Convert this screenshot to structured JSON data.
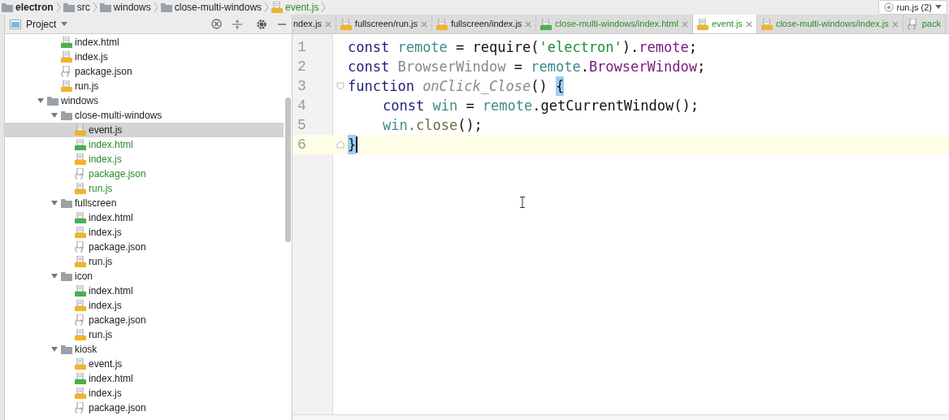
{
  "breadcrumb": [
    {
      "label": "electron",
      "kind": "folder",
      "bold": true
    },
    {
      "label": "src",
      "kind": "folder",
      "bold": false
    },
    {
      "label": "windows",
      "kind": "folder",
      "bold": false
    },
    {
      "label": "close-multi-windows",
      "kind": "folder",
      "bold": false
    },
    {
      "label": "event.js",
      "kind": "js",
      "bold": false
    }
  ],
  "run_config": {
    "label": "run.js (2)"
  },
  "project_panel": {
    "title": "Project"
  },
  "tree": [
    {
      "children": [
        {
          "label": "index.html",
          "kind": "html",
          "modified": false,
          "selected": false
        },
        {
          "label": "index.js",
          "kind": "js",
          "modified": false,
          "selected": false
        },
        {
          "label": "package.json",
          "kind": "json",
          "modified": false,
          "selected": false
        },
        {
          "label": "run.js",
          "kind": "js",
          "modified": false,
          "selected": false
        }
      ]
    },
    {
      "label": "windows",
      "kind": "folder",
      "expanded": true,
      "modified": false,
      "selected": false,
      "children": [
        {
          "label": "close-multi-windows",
          "kind": "folder",
          "expanded": true,
          "modified": false,
          "selected": false,
          "children": [
            {
              "label": "event.js",
              "kind": "js",
              "modified": false,
              "selected": true
            },
            {
              "label": "index.html",
              "kind": "html",
              "modified": true,
              "selected": false
            },
            {
              "label": "index.js",
              "kind": "js",
              "modified": true,
              "selected": false
            },
            {
              "label": "package.json",
              "kind": "json",
              "modified": true,
              "selected": false
            },
            {
              "label": "run.js",
              "kind": "js",
              "modified": true,
              "selected": false
            }
          ]
        },
        {
          "label": "fullscreen",
          "kind": "folder",
          "expanded": true,
          "modified": false,
          "selected": false,
          "children": [
            {
              "label": "index.html",
              "kind": "html",
              "modified": false,
              "selected": false
            },
            {
              "label": "index.js",
              "kind": "js",
              "modified": false,
              "selected": false
            },
            {
              "label": "package.json",
              "kind": "json",
              "modified": false,
              "selected": false
            },
            {
              "label": "run.js",
              "kind": "js",
              "modified": false,
              "selected": false
            }
          ]
        },
        {
          "label": "icon",
          "kind": "folder",
          "expanded": true,
          "modified": false,
          "selected": false,
          "children": [
            {
              "label": "index.html",
              "kind": "html",
              "modified": false,
              "selected": false
            },
            {
              "label": "index.js",
              "kind": "js",
              "modified": false,
              "selected": false
            },
            {
              "label": "package.json",
              "kind": "json",
              "modified": false,
              "selected": false
            },
            {
              "label": "run.js",
              "kind": "js",
              "modified": false,
              "selected": false
            }
          ]
        },
        {
          "label": "kiosk",
          "kind": "folder",
          "expanded": true,
          "modified": false,
          "selected": false,
          "children": [
            {
              "label": "event.js",
              "kind": "js",
              "modified": false,
              "selected": false
            },
            {
              "label": "index.html",
              "kind": "html",
              "modified": false,
              "selected": false
            },
            {
              "label": "index.js",
              "kind": "js",
              "modified": false,
              "selected": false
            },
            {
              "label": "package.json",
              "kind": "json",
              "modified": false,
              "selected": false
            }
          ]
        }
      ]
    }
  ],
  "tabs": [
    {
      "label": "ndex.js",
      "kind": "none",
      "modified": false,
      "selected": false,
      "closable": true
    },
    {
      "label": "fullscreen/run.js",
      "kind": "js",
      "modified": false,
      "selected": false,
      "closable": true
    },
    {
      "label": "fullscreen/index.js",
      "kind": "js",
      "modified": false,
      "selected": false,
      "closable": true
    },
    {
      "label": "close-multi-windows/index.html",
      "kind": "html",
      "modified": true,
      "selected": false,
      "closable": true
    },
    {
      "label": "event.js",
      "kind": "js",
      "modified": true,
      "selected": true,
      "closable": true
    },
    {
      "label": "close-multi-windows/index.js",
      "kind": "js",
      "modified": true,
      "selected": false,
      "closable": true
    },
    {
      "label": "pack",
      "kind": "json",
      "modified": true,
      "selected": false,
      "closable": false
    }
  ],
  "editor": {
    "lines": [
      {
        "number": "1",
        "indented": false,
        "current": false,
        "fold_open": false,
        "fold_close": false,
        "tokens": [
          {
            "text": "const ",
            "kind": "kw"
          },
          {
            "text": "remote",
            "kind": "local"
          },
          {
            "text": " = require(",
            "kind": "plain"
          },
          {
            "text": "'electron'",
            "kind": "str"
          },
          {
            "text": ").",
            "kind": "plain"
          },
          {
            "text": "remote",
            "kind": "prop"
          },
          {
            "text": ";",
            "kind": "plain"
          }
        ]
      },
      {
        "number": "2",
        "indented": false,
        "current": false,
        "fold_open": false,
        "fold_close": false,
        "tokens": [
          {
            "text": "const ",
            "kind": "kw"
          },
          {
            "text": "BrowserWindow",
            "kind": "unused"
          },
          {
            "text": " = ",
            "kind": "plain"
          },
          {
            "text": "remote",
            "kind": "local"
          },
          {
            "text": ".",
            "kind": "plain"
          },
          {
            "text": "BrowserWindow",
            "kind": "prop"
          },
          {
            "text": ";",
            "kind": "plain"
          }
        ]
      },
      {
        "number": "3",
        "indented": false,
        "current": false,
        "fold_open": true,
        "fold_close": false,
        "tokens": [
          {
            "text": "function ",
            "kind": "kw"
          },
          {
            "text": "onClick_Close",
            "kind": "fn"
          },
          {
            "text": "() ",
            "kind": "plain"
          },
          {
            "text": "{",
            "kind": "match"
          }
        ]
      },
      {
        "number": "4",
        "indented": true,
        "current": false,
        "fold_open": false,
        "fold_close": false,
        "tokens": [
          {
            "text": "const ",
            "kind": "kw"
          },
          {
            "text": "win",
            "kind": "local"
          },
          {
            "text": " = ",
            "kind": "plain"
          },
          {
            "text": "remote",
            "kind": "local"
          },
          {
            "text": ".getCurrentWindow();",
            "kind": "plain"
          }
        ]
      },
      {
        "number": "5",
        "indented": true,
        "current": false,
        "fold_open": false,
        "fold_close": false,
        "tokens": [
          {
            "text": "win",
            "kind": "local"
          },
          {
            "text": ".close",
            "kind": "method"
          },
          {
            "text": "();",
            "kind": "plain"
          }
        ]
      },
      {
        "number": "6",
        "indented": false,
        "current": true,
        "fold_open": false,
        "fold_close": true,
        "tokens": [
          {
            "text": "}",
            "kind": "match"
          }
        ]
      }
    ]
  }
}
